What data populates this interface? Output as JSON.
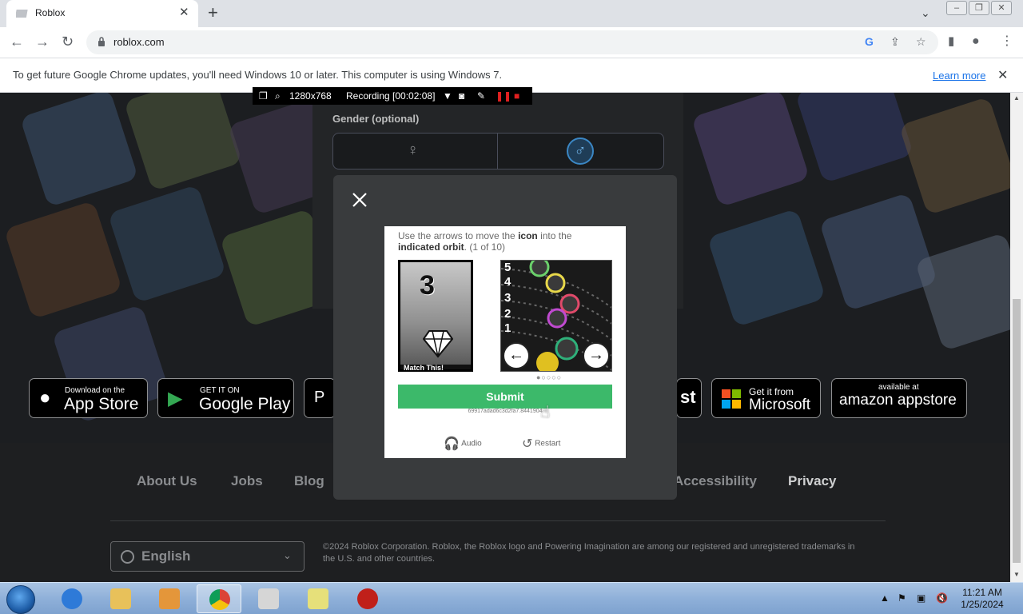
{
  "browser": {
    "tab_title": "Roblox",
    "url": "roblox.com",
    "update_message": "To get future Google Chrome updates, you'll need Windows 10 or later. This computer is using Windows 7.",
    "learn_more": "Learn more"
  },
  "recorder": {
    "resolution": "1280x768",
    "status": "Recording [00:02:08]"
  },
  "signup": {
    "gender_label": "Gender (optional)"
  },
  "stores": [
    {
      "small": "Download on the",
      "large": "App Store"
    },
    {
      "small": "GET IT ON",
      "large": "Google Play"
    },
    {
      "small": "Get it from",
      "large": "Microsoft"
    },
    {
      "small": "available at",
      "large": "amazon appstore"
    }
  ],
  "footer": {
    "links": [
      "About Us",
      "Jobs",
      "Blog",
      "Accessibility",
      "Privacy"
    ],
    "language": "English",
    "copyright": "©2024 Roblox Corporation. Roblox, the Roblox logo and Powering Imagination are among our registered and unregistered trademarks in the U.S. and other countries."
  },
  "captcha": {
    "instruction_pre": "Use the arrows to move the ",
    "instruction_icon": "icon",
    "instruction_mid": " into the ",
    "instruction_orbit": "indicated orbit",
    "instruction_post": ". (1 of 10)",
    "target_number": "3",
    "target_caption": "Match This!",
    "orbit_numbers": [
      "5",
      "4",
      "3",
      "2",
      "1"
    ],
    "submit": "Submit",
    "session_id": "69917adad6c3d2fa7.8441904",
    "audio": "Audio",
    "restart": "Restart",
    "page_dots": "●○○○○"
  },
  "taskbar": {
    "time": "11:21 AM",
    "date": "1/25/2024"
  },
  "colors": {
    "submit": "#3cb96a",
    "modal": "#393b3d",
    "link": "#1a73e8"
  }
}
